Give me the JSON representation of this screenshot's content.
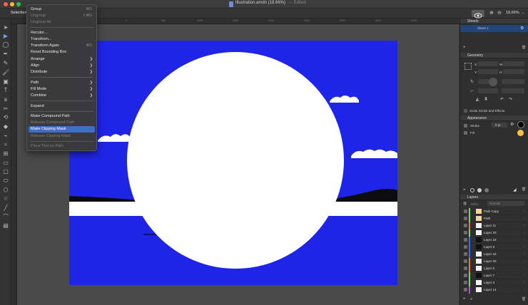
{
  "window": {
    "title": "Illustration.amdn (18.66%)",
    "edited": "— Edited",
    "traffic_colors": [
      "#ff5f57",
      "#febc2e",
      "#28c840"
    ]
  },
  "toolbar": {
    "tab_label": "Selection",
    "zoom": "18,66%"
  },
  "context_menu": {
    "items": [
      {
        "label": "Group",
        "shortcut": "⌘G",
        "enabled": true
      },
      {
        "label": "Ungroup",
        "shortcut": "⇧⌘G",
        "enabled": false
      },
      {
        "label": "Ungroup All",
        "shortcut": "",
        "enabled": false
      },
      {
        "label": "Recolor...",
        "shortcut": "",
        "enabled": true
      },
      {
        "label": "Transform...",
        "shortcut": "",
        "enabled": true
      },
      {
        "label": "Transform Again",
        "shortcut": "⌘D",
        "enabled": true
      },
      {
        "label": "Reset Bounding Box",
        "shortcut": "",
        "enabled": true
      },
      {
        "label": "Arrange",
        "submenu": true,
        "enabled": true
      },
      {
        "label": "Align",
        "submenu": true,
        "enabled": true
      },
      {
        "label": "Distribute",
        "submenu": true,
        "enabled": true
      },
      {
        "label": "Path",
        "submenu": true,
        "enabled": true
      },
      {
        "label": "Fill Mode",
        "submenu": true,
        "enabled": true
      },
      {
        "label": "Combine",
        "submenu": true,
        "enabled": true
      },
      {
        "label": "Expand",
        "shortcut": "",
        "enabled": true
      },
      {
        "label": "Make Compound Path",
        "shortcut": "",
        "enabled": true
      },
      {
        "label": "Release Compound Path",
        "shortcut": "",
        "enabled": false
      },
      {
        "label": "Make Clipping Mask",
        "shortcut": "",
        "enabled": true,
        "highlighted": true
      },
      {
        "label": "Release Clipping Mask",
        "shortcut": "",
        "enabled": false
      },
      {
        "label": "Place Text on Path",
        "shortcut": "",
        "enabled": false
      }
    ]
  },
  "sidebar": {
    "sheets": {
      "title": "Sheets",
      "items": [
        "Sheet 1"
      ]
    },
    "geometry": {
      "title": "Geometry",
      "labels": {
        "x": "X:",
        "y": "Y:",
        "w": "W:",
        "h": "H:"
      },
      "scale_label": "Scale Stroke and Effects"
    },
    "appearance": {
      "title": "Appearance",
      "stroke_label": "Stroke",
      "stroke_value": "0 pt",
      "fill_label": "Fill",
      "fill_color": "#f5c242"
    },
    "layers": {
      "title": "Layers",
      "opacity": "100%",
      "blend": "Normal",
      "rows": [
        {
          "name": "Path Copy",
          "color": "#7cd36a"
        },
        {
          "name": "Path",
          "color": "#7cd36a"
        },
        {
          "name": "Layer 11",
          "color": "#e07a3a"
        },
        {
          "name": "Layer 20",
          "color": "#7cd36a"
        },
        {
          "name": "Layer 18",
          "color": "#3a6be0"
        },
        {
          "name": "Layer 8",
          "color": "#3a6be0"
        },
        {
          "name": "Layer 16",
          "color": "#3a6be0"
        },
        {
          "name": "Layer 20",
          "color": "#e07a3a"
        },
        {
          "name": "Layer 6",
          "color": "#e07a3a"
        },
        {
          "name": "Layer 7",
          "color": "#7cd36a"
        },
        {
          "name": "Layer 3",
          "color": "#7cd36a"
        },
        {
          "name": "Layer 14",
          "color": "#b14ed1"
        }
      ]
    }
  },
  "ruler": {
    "ticks": [
      "-1000",
      "-500",
      "0",
      "500",
      "1000",
      "1500",
      "2000",
      "2500",
      "3000",
      "3500",
      "4000"
    ]
  },
  "artboard": {
    "bg_color": "#1f25e6"
  }
}
